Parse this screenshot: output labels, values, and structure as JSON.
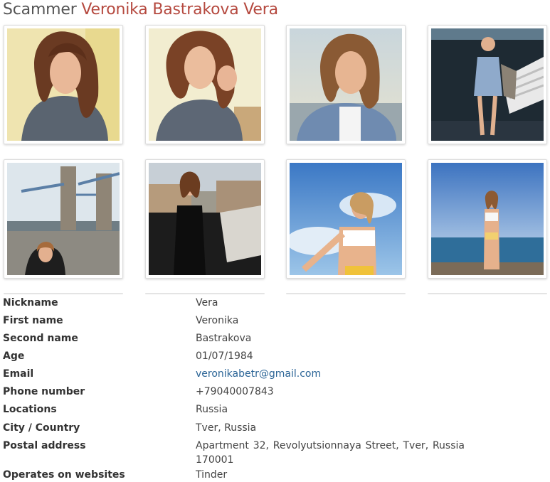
{
  "title": {
    "prefix": "Scammer",
    "name": "Veronika Bastrakova Vera"
  },
  "photos": [
    {
      "icon": "photo-woman-selfie-sweater"
    },
    {
      "icon": "photo-woman-selfie-hand"
    },
    {
      "icon": "photo-woman-denim-jacket"
    },
    {
      "icon": "photo-woman-stairs"
    },
    {
      "icon": "photo-tower-bridge"
    },
    {
      "icon": "photo-woman-black-dress"
    },
    {
      "icon": "photo-woman-sky-bikini"
    },
    {
      "icon": "photo-woman-beach"
    }
  ],
  "details": [
    {
      "label": "Nickname",
      "value": "Vera"
    },
    {
      "label": "First name",
      "value": "Veronika"
    },
    {
      "label": "Second name",
      "value": "Bastrakova"
    },
    {
      "label": "Age",
      "value": "01/07/1984"
    },
    {
      "label": "Email",
      "value": "veronikabetr@gmail.com"
    },
    {
      "label": "Phone number",
      "value": "+79040007843"
    },
    {
      "label": "Locations",
      "value": "Russia"
    },
    {
      "label": "City / Country",
      "value": "Tver, Russia"
    },
    {
      "label": "Postal address",
      "value": "Apartment 32, Revolyutsionnaya Street, Tver, Russia 170001"
    },
    {
      "label": "Operates on websites",
      "value": "Tinder"
    }
  ],
  "colors": {
    "accent": "#b5493f",
    "link": "#2a6496"
  }
}
